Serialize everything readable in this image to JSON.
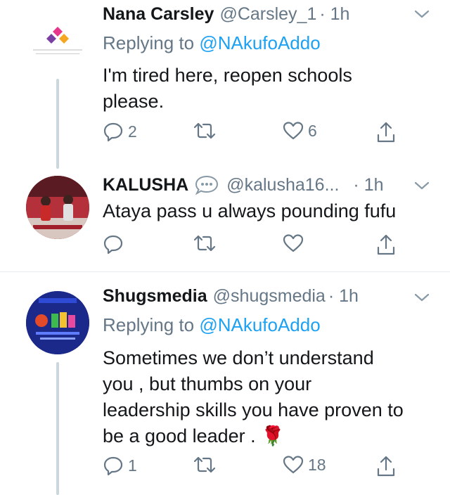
{
  "tweets": [
    {
      "name": "Nana Carsley",
      "handle": "@Carsley_1",
      "time": "· 1h",
      "replying_prefix": "Replying to ",
      "replying_to": "@NAkufoAddo",
      "text_lines": [
        "I'm tired here, reopen schools",
        "please."
      ],
      "reply_count": "2",
      "retweet_count": "",
      "like_count": "6",
      "avatar_caption": "CARSLEY'S PHOTOGRAPHY"
    },
    {
      "name": "KALUSHA",
      "handle": "@kalusha16...",
      "time": "· 1h",
      "text_lines": [
        "Ataya pass u always pounding fufu"
      ],
      "reply_count": "",
      "retweet_count": "",
      "like_count": ""
    },
    {
      "name": "Shugsmedia",
      "handle": "@shugsmedia",
      "time": "· 1h",
      "replying_prefix": "Replying to ",
      "replying_to": "@NAkufoAddo",
      "text_lines": [
        "Sometimes we don’t understand",
        "you , but thumbs on your",
        "leadership skills you have proven to",
        "be a good leader . 🌹"
      ],
      "reply_count": "1",
      "retweet_count": "",
      "like_count": "18",
      "avatar_caption": "GRAPHIC DESIGNER"
    }
  ],
  "icons": {
    "reply": "reply-icon",
    "retweet": "retweet-icon",
    "like": "heart-icon",
    "share": "share-icon",
    "more": "chevron-down-icon",
    "speech": "speech-bubble-icon"
  },
  "colors": {
    "link": "#1da1f2",
    "secondary": "#657786",
    "thread_line": "#ccd6dd",
    "divider": "#e6ecf0"
  }
}
